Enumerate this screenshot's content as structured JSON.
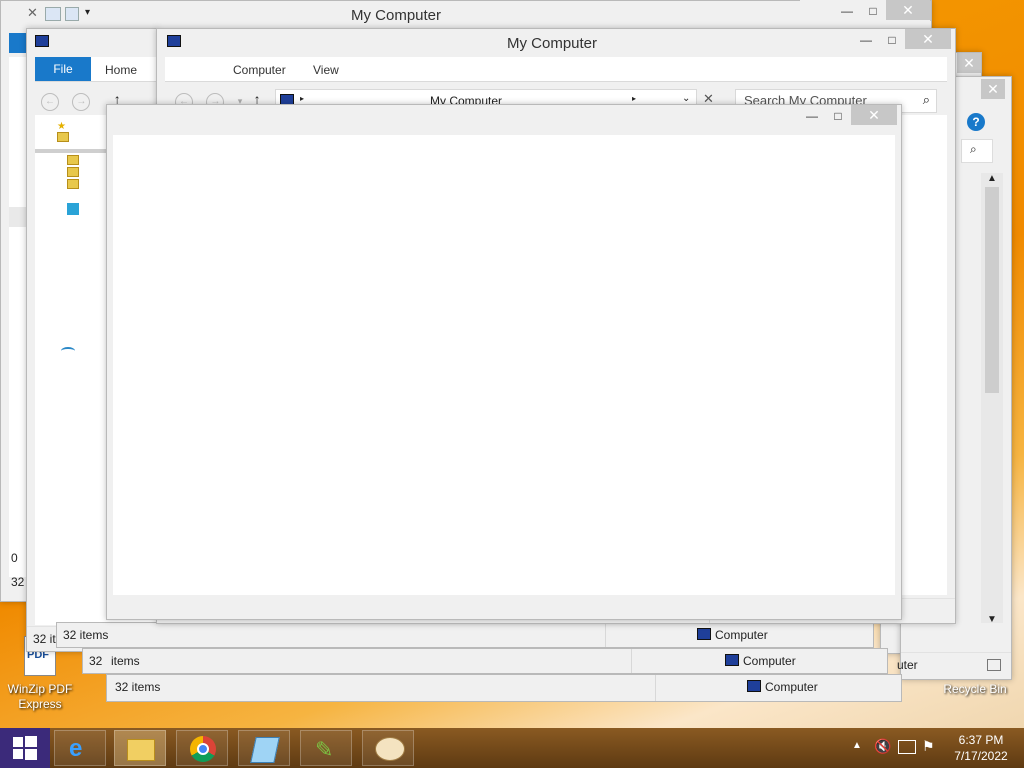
{
  "window": {
    "title": "My Computer",
    "title_back": "My Computer",
    "min_symbol": "—",
    "max_symbol": "□",
    "close_symbol": "✕"
  },
  "ribbon": {
    "file": "File",
    "home": "Home",
    "computer": "Computer",
    "view": "View"
  },
  "address": {
    "location": "My Computer",
    "search_placeholder": "Search My Computer"
  },
  "status": {
    "items": "32 items",
    "items_partial": "items",
    "computer": "Computer",
    "computer_partial": "uter"
  },
  "desktop": {
    "winzip_label": "WinZip PDF Express",
    "winzip_badge": "PDF",
    "recycle_bin": "Recycle Bin"
  },
  "misc": {
    "zero": "0",
    "items_count_short": "32"
  },
  "clock": {
    "time": "6:37 PM",
    "date": "7/17/2022"
  },
  "colors": {
    "accent": "#1979ca",
    "taskbar": "#6e4517",
    "close": "#c7c7c7"
  }
}
